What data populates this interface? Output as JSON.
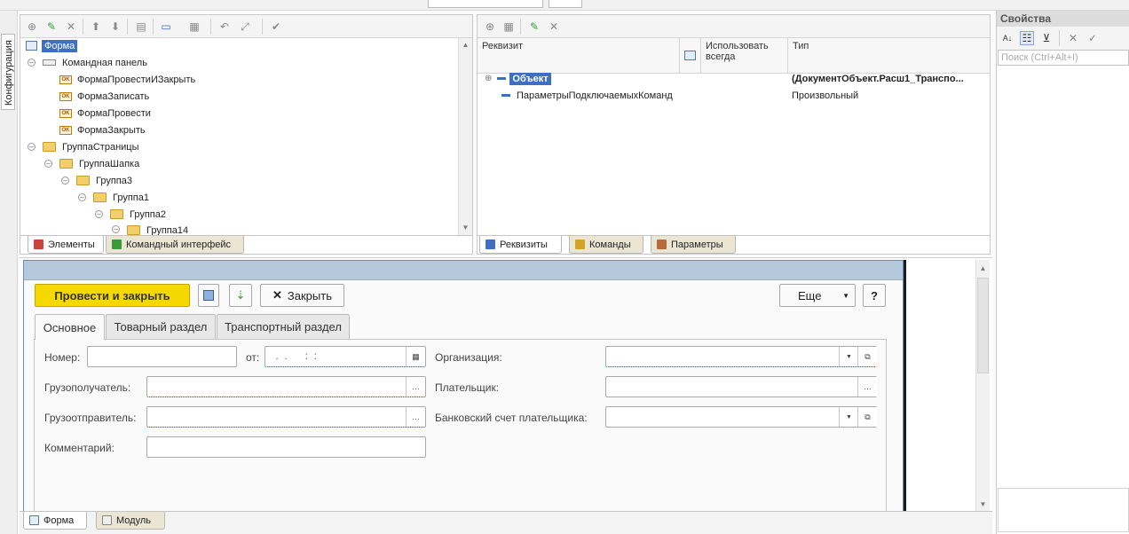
{
  "sidebar": {
    "config_tab": "Конфигурация"
  },
  "elements_tree": {
    "items": [
      {
        "label": "Форма"
      },
      {
        "label": "Командная панель"
      },
      {
        "label": "ФормаПровестиИЗакрыть"
      },
      {
        "label": "ФормаЗаписать"
      },
      {
        "label": "ФормаПровести"
      },
      {
        "label": "ФормаЗакрыть"
      },
      {
        "label": "ГруппаСтраницы"
      },
      {
        "label": "ГруппаШапка"
      },
      {
        "label": "Группа3"
      },
      {
        "label": "Группа1"
      },
      {
        "label": "Группа2"
      },
      {
        "label": "Группа14"
      }
    ],
    "tabs": {
      "elements": "Элементы",
      "command_interface": "Командный интерфейс"
    },
    "ok_badge": "OK"
  },
  "requisites": {
    "columns": {
      "requisite": "Реквизит",
      "use_always": "Использовать всегда",
      "type": "Тип"
    },
    "rows": [
      {
        "name": "Объект",
        "type": "(ДокументОбъект.Расш1_Транспо..."
      },
      {
        "name": "ПараметрыПодключаемыхКоманд",
        "type": "Произвольный"
      }
    ],
    "tabs": {
      "requisites": "Реквизиты",
      "commands": "Команды",
      "parameters": "Параметры"
    }
  },
  "properties": {
    "title": "Свойства",
    "search_placeholder": "Поиск (Ctrl+Alt+I)"
  },
  "form": {
    "post_close": "Провести и закрыть",
    "close": "Закрыть",
    "more": "Еще",
    "help": "?",
    "tabs": {
      "main": "Основное",
      "goods": "Товарный раздел",
      "transport": "Транспортный раздел"
    },
    "fields": {
      "number": "Номер:",
      "from": "от:",
      "date_mask": " .  .      :  :",
      "organization": "Организация:",
      "consignee": "Грузополучатель:",
      "payer": "Плательщик:",
      "shipper": "Грузоотправитель:",
      "bank_account": "Банковский счет плательщика:",
      "comment": "Комментарий:"
    },
    "bottom_tabs": {
      "form": "Форма",
      "module": "Модуль"
    }
  },
  "colors": {
    "accent_yellow": "#f5d800",
    "selection": "#3d6fc4",
    "form_header": "#b5c8dc"
  }
}
